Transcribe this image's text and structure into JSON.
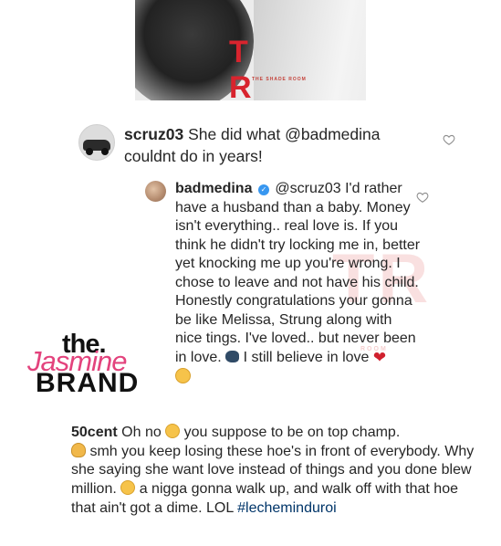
{
  "photo": {
    "logo_text": "T R",
    "logo_subtext": "THE SHADE ROOM"
  },
  "comments": [
    {
      "username": "scruz03",
      "text": "She did what @badmedina couldnt do in years!"
    },
    {
      "username": "badmedina",
      "verified": true,
      "text_main": "@scruz03 I'd rather have a husband than a baby. Money isn't everything.. real love is. If you think he didn't try locking me in, better yet knocking me up you're wrong. I chose to leave and not have his child. Honestly congratulations your gonna be like Melissa, Strung along with nice tings. I've loved.. but never been in love.",
      "text_tail": "I still believe in love"
    },
    {
      "username": "50cent",
      "text_1": "Oh no",
      "text_2": "you suppose to be on top champ.",
      "text_3": "smh you keep losing these hoe's in front of everybody. Why she saying she want love instead of things and you done blew million.",
      "text_4": "a nigga gonna walk up, and walk off with that hoe that ain't got a dime. LOL",
      "hashtag": "#lecheminduroi"
    }
  ],
  "watermarks": {
    "shade_room_big": "TR",
    "shade_room_small": "ROOM",
    "brand_the": "the.",
    "brand_jasmine": "Jasmine",
    "brand_brand": "BRAND"
  },
  "colors": {
    "heart_red": "#d0202e",
    "hashtag_blue": "#003569",
    "verified_blue": "#3897f0",
    "jasmine_pink": "#e3437d"
  },
  "icons": {
    "like": "heart-outline-icon",
    "verified": "verified-badge-icon"
  }
}
